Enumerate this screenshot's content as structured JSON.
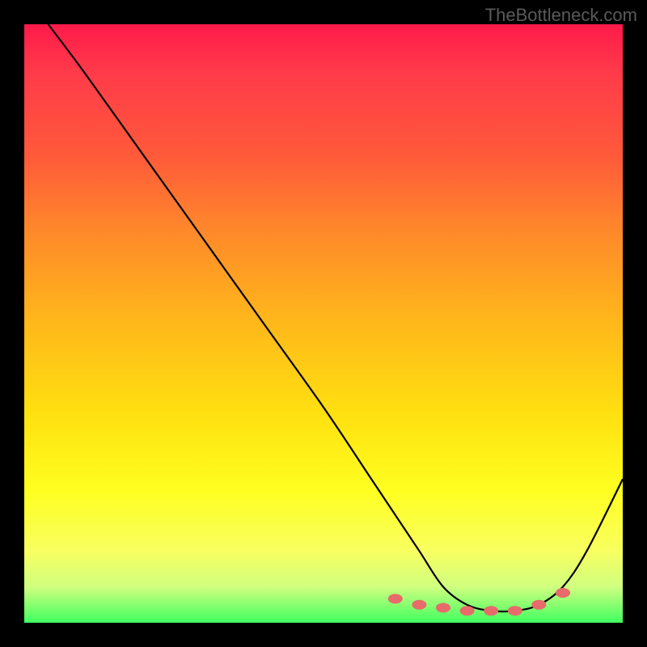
{
  "watermark": "TheBottleneck.com",
  "chart_data": {
    "type": "line",
    "title": "",
    "xlabel": "",
    "ylabel": "",
    "xlim": [
      0,
      100
    ],
    "ylim": [
      0,
      100
    ],
    "series": [
      {
        "name": "curve",
        "x": [
          4,
          10,
          20,
          30,
          40,
          50,
          58,
          62,
          66,
          70,
          74,
          78,
          82,
          86,
          90,
          94,
          100
        ],
        "y": [
          100,
          92,
          78,
          64,
          50,
          36,
          24,
          18,
          12,
          6,
          3,
          2,
          2,
          3,
          6,
          12,
          24
        ]
      }
    ],
    "markers": {
      "name": "highlight-dots",
      "color": "#e86a6a",
      "x": [
        62,
        66,
        70,
        74,
        78,
        82,
        86,
        90
      ],
      "y": [
        4,
        3,
        2.5,
        2,
        2,
        2,
        3,
        5
      ]
    },
    "gradient_stops": [
      {
        "pos": 0,
        "color": "#ff1a4a"
      },
      {
        "pos": 50,
        "color": "#ffe010"
      },
      {
        "pos": 100,
        "color": "#40ff60"
      }
    ]
  }
}
